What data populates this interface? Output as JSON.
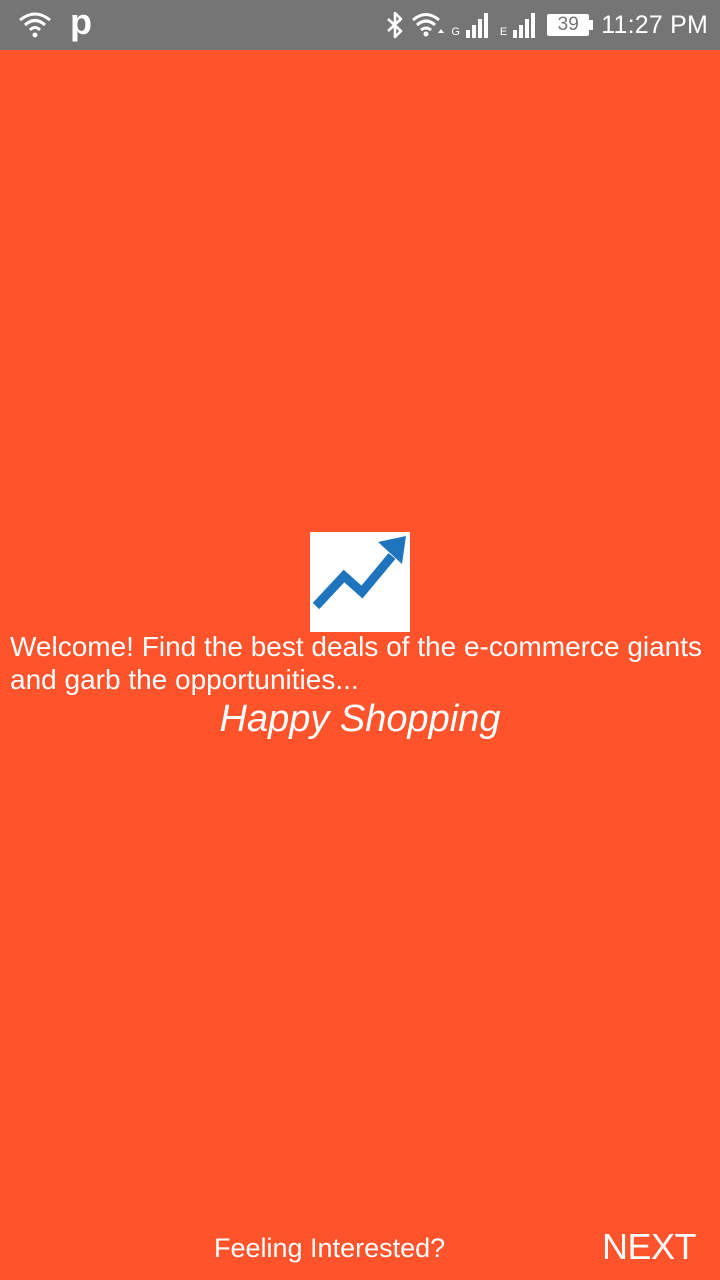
{
  "status_bar": {
    "app_letter": "p",
    "network_g": "G",
    "network_e": "E",
    "battery_level": "39",
    "time": "11:27 PM",
    "icons": [
      "wifi-icon",
      "bluetooth-icon",
      "wifi-data-icon",
      "signal-icon",
      "signal-icon",
      "battery-icon"
    ]
  },
  "main": {
    "logo_icon": "trending-up-icon",
    "logo_color": "#1E75BD",
    "welcome_text": "Welcome! Find the best deals of the e-commerce giants and garb the opportunities...",
    "happy_text": "Happy Shopping"
  },
  "footer": {
    "feeling_text": "Feeling Interested?",
    "next_label": "NEXT"
  },
  "colors": {
    "background": "#FF532B",
    "status_bar": "#757575",
    "text": "#FFFFFF"
  }
}
